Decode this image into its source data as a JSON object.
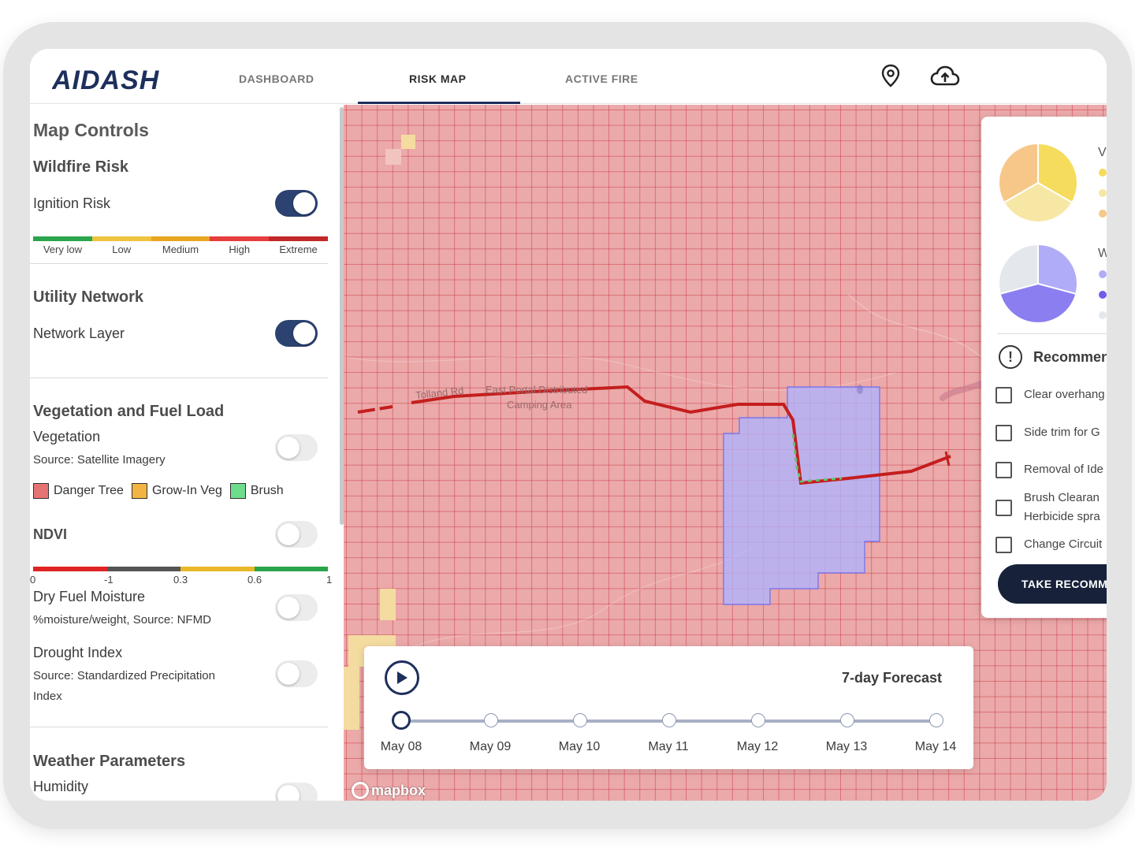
{
  "nav": {
    "logo": "AIDASH",
    "tabs": [
      {
        "label": "DASHBOARD"
      },
      {
        "label": "RISK MAP"
      },
      {
        "label": "ACTIVE FIRE"
      }
    ],
    "active_tab": "RISK MAP",
    "icons": [
      "map-pin-icon",
      "cloud-upload-icon"
    ]
  },
  "sidebar": {
    "title": "Map Controls",
    "wildfire": {
      "heading": "Wildfire Risk",
      "ignition_label": "Ignition Risk",
      "ignition_on": true,
      "scale_labels": [
        "Very low",
        "Low",
        "Medium",
        "High",
        "Extreme"
      ],
      "scale_colors": [
        "#2aa54b",
        "#efc23f",
        "#e8a51f",
        "#e63d3d",
        "#c22828"
      ]
    },
    "utility": {
      "heading": "Utility Network",
      "network_label": "Network Layer",
      "network_on": true
    },
    "vegetation": {
      "heading": "Vegetation and Fuel Load",
      "veg_label": "Vegetation",
      "veg_source": "Source: Satellite Imagery",
      "veg_on": false,
      "legend": [
        {
          "label": "Danger Tree",
          "color": "#e57373"
        },
        {
          "label": "Grow-In Veg",
          "color": "#f2b544"
        },
        {
          "label": "Brush",
          "color": "#6ddc8b"
        }
      ],
      "ndvi_label": "NDVI",
      "ndvi_on": false,
      "ndvi_ticks": [
        "0",
        "-1",
        "0.3",
        "0.6",
        "1"
      ],
      "ndvi_colors": [
        "#e02424",
        "#555555",
        "#e8b82a",
        "#2aa54b"
      ],
      "dfm_label": "Dry Fuel Moisture",
      "dfm_source": "%moisture/weight, Source: NFMD",
      "dfm_on": false,
      "drought_label": "Drought Index",
      "drought_source_1": "Source: Standardized Precipitation",
      "drought_source_2": "Index",
      "drought_on": false
    },
    "weather": {
      "heading": "Weather Parameters",
      "humidity_label": "Humidity",
      "humidity_on": false
    }
  },
  "map": {
    "labels": [
      "Tolland Rd",
      "East Portal Distributed",
      "Camping Area"
    ],
    "attribution": "mapbox"
  },
  "timeline": {
    "title": "7-day Forecast",
    "dates": [
      "May 08",
      "May 09",
      "May 10",
      "May 11",
      "May 12",
      "May 13",
      "May 14"
    ],
    "active_index": 0
  },
  "right_panel": {
    "pie1": {
      "colors": [
        "#f5dc5c",
        "#f7e7a4",
        "#f7c78a"
      ],
      "legend_letter": "V"
    },
    "pie2": {
      "colors": [
        "#b0acf7",
        "#8b7ef0",
        "#e4e7ec"
      ],
      "legend_letter": "W"
    },
    "recommend_title": "Recommendations",
    "items": [
      {
        "text": "Clear overhang"
      },
      {
        "text": "Side trim for G"
      },
      {
        "text": "Removal of Ide"
      },
      {
        "text": "Brush Clearan",
        "text2": "Herbicide spra"
      },
      {
        "text": "Change Circuit"
      }
    ],
    "button_label": "TAKE RECOMMENDED ACTION"
  }
}
